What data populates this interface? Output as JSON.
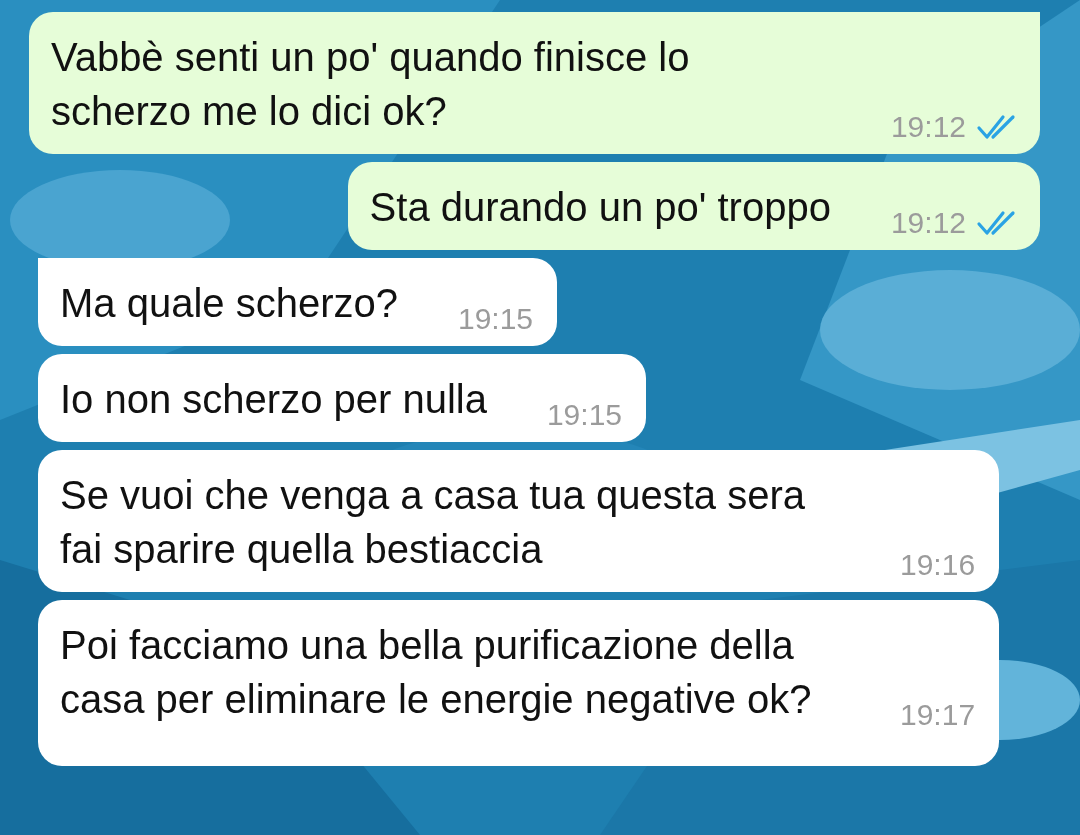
{
  "messages": [
    {
      "kind": "outgoing",
      "tail": true,
      "text": "Vabbè senti un po' quando finisce lo scherzo me lo dici ok?",
      "time": "19:12",
      "read": true
    },
    {
      "kind": "outgoing",
      "tail": false,
      "text": "Sta durando un po' troppo",
      "time": "19:12",
      "read": true
    },
    {
      "kind": "incoming",
      "tail": true,
      "text": "Ma quale scherzo?",
      "time": "19:15"
    },
    {
      "kind": "incoming",
      "tail": false,
      "text": "Io non scherzo per nulla",
      "time": "19:15"
    },
    {
      "kind": "incoming",
      "tail": false,
      "text": "Se vuoi che venga a casa tua questa sera fai sparire quella bestiaccia",
      "time": "19:16"
    },
    {
      "kind": "incoming",
      "tail": false,
      "text": "Poi facciamo una bella purificazione della casa per eliminare le energie negative ok?",
      "time": "19:17"
    }
  ]
}
